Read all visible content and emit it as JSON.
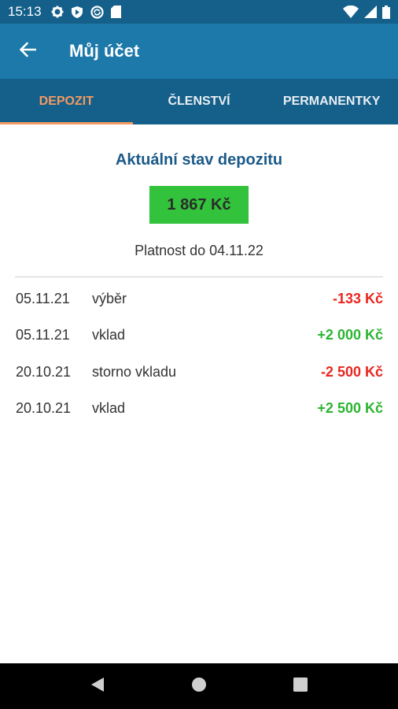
{
  "status_bar": {
    "time": "15:13",
    "left_icons": [
      "settings-icon",
      "shield-icon",
      "sync-icon",
      "sd-card-icon"
    ],
    "right_icons": [
      "wifi-icon",
      "signal-icon",
      "battery-icon"
    ]
  },
  "app_bar": {
    "title": "Můj účet",
    "back_icon": "arrow-back-icon"
  },
  "tabs": [
    {
      "label": "DEPOZIT",
      "active": true
    },
    {
      "label": "ČLENSTVÍ",
      "active": false
    },
    {
      "label": "PERMANENTKY",
      "active": false
    }
  ],
  "deposit": {
    "title": "Aktuální stav depozitu",
    "balance": "1 867 Kč",
    "validity": "Platnost do 04.11.22"
  },
  "transactions": [
    {
      "date": "05.11.21",
      "description": "výběr",
      "amount": "-133 Kč",
      "type": "negative"
    },
    {
      "date": "05.11.21",
      "description": "vklad",
      "amount": "+2 000 Kč",
      "type": "positive"
    },
    {
      "date": "20.10.21",
      "description": "storno vkladu",
      "amount": "-2 500 Kč",
      "type": "negative"
    },
    {
      "date": "20.10.21",
      "description": "vklad",
      "amount": "+2 500 Kč",
      "type": "positive"
    }
  ],
  "colors": {
    "status_bar": "#15608a",
    "app_bar": "#1c79a9",
    "tab_bar": "#15608a",
    "tab_active": "#f29a62",
    "title": "#1b5a88",
    "balance_bg": "#33c23b",
    "negative": "#e8261f",
    "positive": "#2cb431"
  },
  "nav_bar": {
    "buttons": [
      "back-triangle-icon",
      "home-circle-icon",
      "recents-square-icon"
    ]
  }
}
